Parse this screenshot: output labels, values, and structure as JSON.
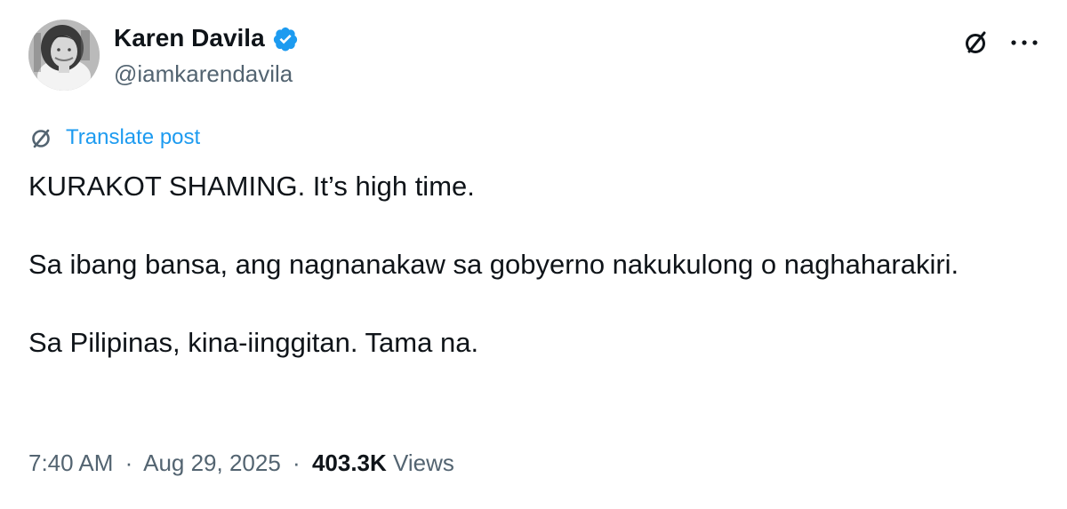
{
  "author": {
    "display_name": "Karen Davila",
    "handle": "@iamkarendavila",
    "verified": true,
    "verified_color": "#1d9bf0"
  },
  "actions": {
    "grok_icon": "slashed-circle-icon",
    "more_icon": "more-icon"
  },
  "translate": {
    "label": "Translate post",
    "icon": "translate-icon",
    "color": "#1d9bf0"
  },
  "body": {
    "paragraph_1": "KURAKOT SHAMING. It’s high time.",
    "paragraph_2": "Sa ibang bansa, ang nagnanakaw sa gobyerno nakukulong o naghaharakiri.",
    "paragraph_3": "Sa Pilipinas, kina-iinggitan. Tama na."
  },
  "meta": {
    "time": "7:40 AM",
    "separator": "·",
    "date": "Aug 29, 2025",
    "views_count": "403.3K",
    "views_label": "Views"
  }
}
